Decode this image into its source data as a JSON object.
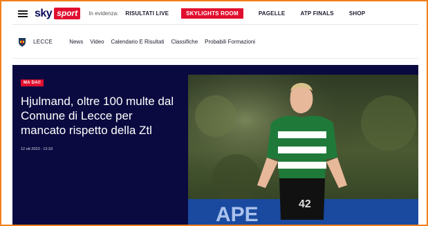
{
  "header": {
    "logo_sky": "sky",
    "logo_sport": "sport",
    "in_evidenza": "In evidenza:",
    "links": [
      {
        "label": "RISULTATI LIVE",
        "highlight": false
      },
      {
        "label": "SKYLIGHTS ROOM",
        "highlight": true
      },
      {
        "label": "PAGELLE",
        "highlight": false
      },
      {
        "label": "ATP FINALS",
        "highlight": false
      },
      {
        "label": "SHOP",
        "highlight": false
      }
    ]
  },
  "team": {
    "name": "LECCE",
    "nav": [
      "News",
      "Video",
      "Calendario E Risultati",
      "Classifiche",
      "Probabili Formazioni"
    ]
  },
  "hero": {
    "tag": "MA DAI!",
    "headline": "Hjulmand, oltre 100 multe dal Comune di Lecce per mancato rispetto della Ztl",
    "date": "12 ott 2023 - 12:33",
    "jersey_number": "42",
    "banner_text": "APE"
  },
  "colors": {
    "accent": "#e10f2f",
    "hero_bg": "#0b0a40",
    "frame": "#f07f1b"
  }
}
